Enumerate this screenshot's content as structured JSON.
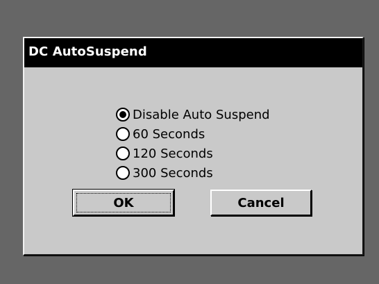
{
  "dialog": {
    "title": "DC AutoSuspend",
    "options": [
      {
        "label": "Disable Auto Suspend",
        "selected": true
      },
      {
        "label": "60 Seconds",
        "selected": false
      },
      {
        "label": "120 Seconds",
        "selected": false
      },
      {
        "label": "300 Seconds",
        "selected": false
      }
    ],
    "ok_label": "OK",
    "cancel_label": "Cancel"
  },
  "colors": {
    "desktop": "#666666",
    "dialog_face": "#c9c9c9",
    "titlebar": "#000000",
    "title_text": "#ffffff"
  }
}
